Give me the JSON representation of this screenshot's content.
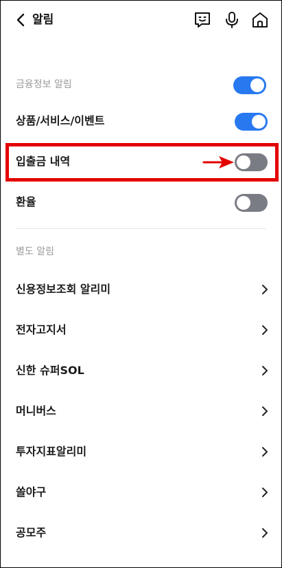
{
  "header": {
    "title": "알림",
    "icons": [
      "back-icon",
      "chat-bot-icon",
      "microphone-icon",
      "home-icon"
    ]
  },
  "sections": {
    "financial": {
      "title": "금융정보 알림"
    },
    "separate": {
      "title": "별도 알림"
    }
  },
  "toggles": [
    {
      "label": "상품/서비스/이벤트",
      "on": true
    },
    {
      "label": "입출금 내역",
      "on": false
    },
    {
      "label": "환율",
      "on": false
    }
  ],
  "financial_master_on": true,
  "links": [
    {
      "label": "신용정보조회 알리미"
    },
    {
      "label": "전자고지서"
    },
    {
      "label": "신한 슈퍼SOL"
    },
    {
      "label": "머니버스"
    },
    {
      "label": "투자지표알리미"
    },
    {
      "label": "쏠야구"
    },
    {
      "label": "공모주"
    }
  ],
  "colors": {
    "toggle_on": "#2879f0",
    "toggle_off": "#7a7c84",
    "highlight": "#e30000"
  }
}
